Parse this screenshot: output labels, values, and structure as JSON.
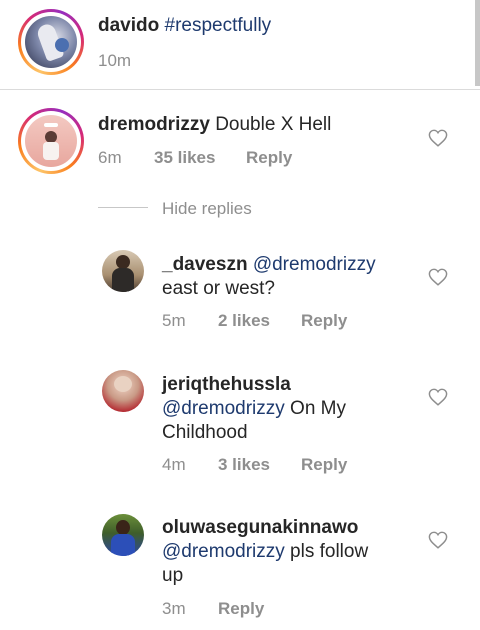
{
  "caption": {
    "username": "davido",
    "text": "#respectfully",
    "time": "10m"
  },
  "comments": [
    {
      "username": "dremodrizzy",
      "text": "Double X Hell",
      "time": "6m",
      "likes": "35 likes",
      "reply": "Reply"
    }
  ],
  "hide_replies": "Hide replies",
  "replies": [
    {
      "username": "_daveszn",
      "mention": "@dremodrizzy",
      "text": "east or west?",
      "time": "5m",
      "likes": "2 likes",
      "reply": "Reply"
    },
    {
      "username": "jeriqthehussla",
      "mention": "@dremodrizzy",
      "text_line1": "On My",
      "text_line2": "Childhood",
      "time": "4m",
      "likes": "3 likes",
      "reply": "Reply"
    },
    {
      "username": "oluwasegunakinnawo",
      "mention": "@dremodrizzy",
      "text_line1": "pls follow",
      "text_line2": "up",
      "time": "3m",
      "reply": "Reply"
    }
  ],
  "colors": {
    "mention": "#1e3a6e",
    "meta": "#8e8e8e",
    "divider": "#dbdbdb"
  },
  "icons": [
    "heart-icon"
  ]
}
